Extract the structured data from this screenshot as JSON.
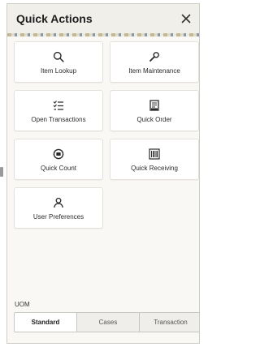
{
  "header": {
    "title": "Quick Actions",
    "close_icon": "close-icon"
  },
  "tiles": [
    {
      "label": "Item Lookup",
      "icon": "search-icon"
    },
    {
      "label": "Item Maintenance",
      "icon": "wrench-icon"
    },
    {
      "label": "Open Transactions",
      "icon": "checklist-icon"
    },
    {
      "label": "Quick Order",
      "icon": "order-receipt-icon"
    },
    {
      "label": "Quick Count",
      "icon": "count-icon"
    },
    {
      "label": "Quick Receiving",
      "icon": "barcode-icon"
    },
    {
      "label": "User Preferences",
      "icon": "user-icon"
    }
  ],
  "uom": {
    "label": "UOM",
    "options": [
      "Standard",
      "Cases",
      "Transaction"
    ],
    "selected": "Standard"
  }
}
